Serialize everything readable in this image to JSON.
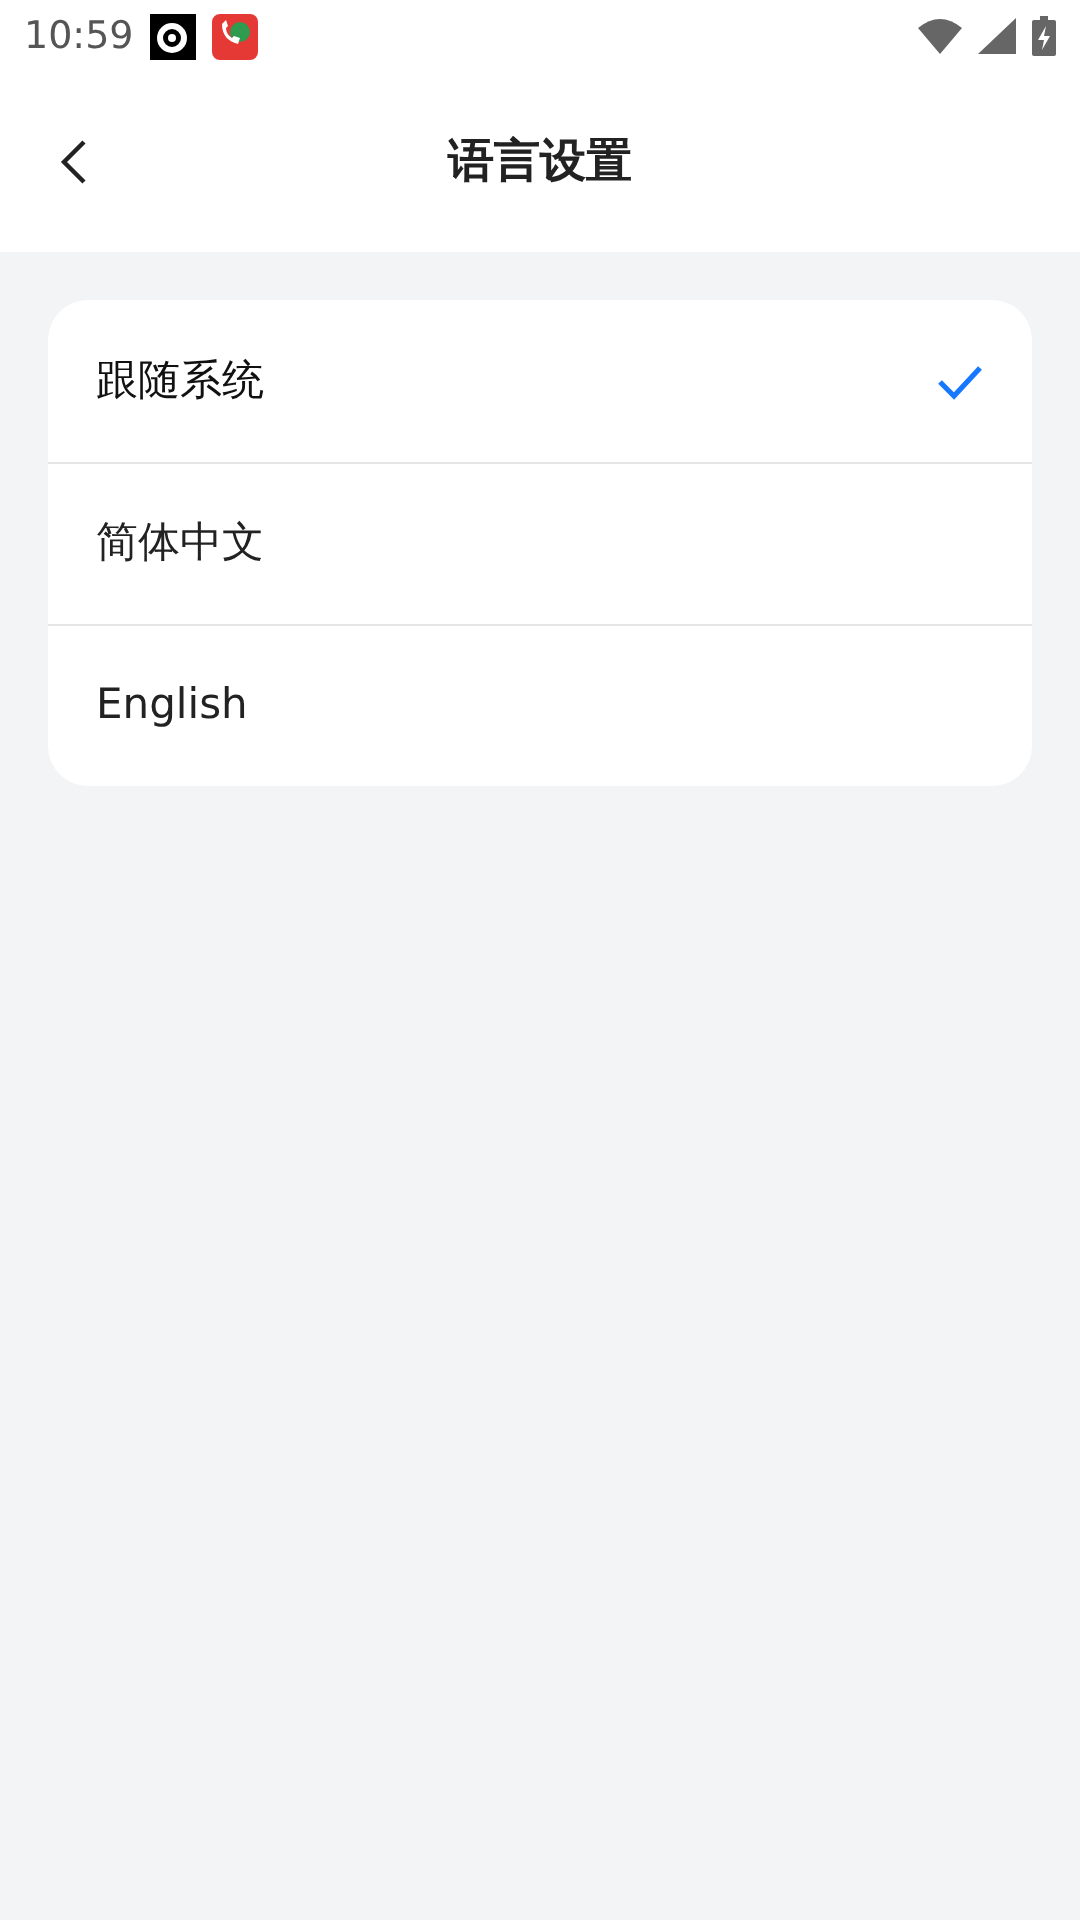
{
  "status_bar": {
    "time": "10:59"
  },
  "header": {
    "title": "语言设置"
  },
  "languages": [
    {
      "label": "跟随系统",
      "selected": true
    },
    {
      "label": "简体中文",
      "selected": false
    },
    {
      "label": "English",
      "selected": false
    }
  ]
}
